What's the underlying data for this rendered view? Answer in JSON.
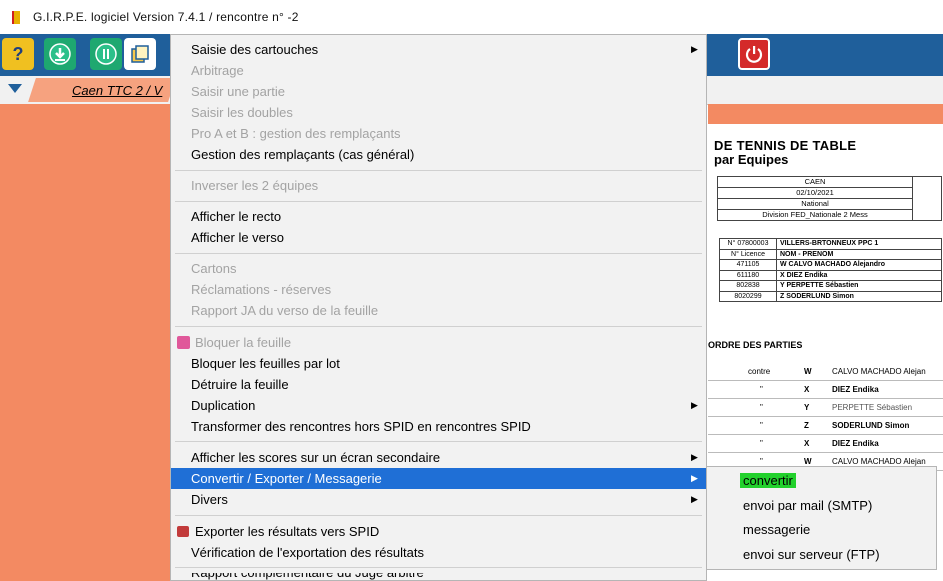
{
  "window": {
    "title": "G.I.R.P.E.  logiciel Version 7.4.1  /  rencontre n° -2"
  },
  "toolbar": {
    "icons": [
      "help-icon",
      "download-icon",
      "info-icon",
      "copy-icon",
      "power-icon"
    ],
    "help_glyph": "?"
  },
  "tab": {
    "label": "Caen TTC 2 / V"
  },
  "sheet": {
    "title": "DE TENNIS DE TABLE",
    "subtitle": "par Equipes",
    "header_box": [
      "CAEN",
      "02/10/2021",
      "National",
      "Division  FED_Nationale 2 Mess"
    ],
    "team_box": [
      [
        "N° 07800003",
        "VILLERS-BRTONNEUX PPC  1"
      ],
      [
        "N° Licence",
        "NOM - PRENOM"
      ],
      [
        "471105",
        "W  CALVO MACHADO Alejandro"
      ],
      [
        "611180",
        "X  DIEZ Endika"
      ],
      [
        "802838",
        "Y  PERPETTE  Sébastien"
      ],
      [
        "8020299",
        "Z  SODERLUND  Simon"
      ]
    ],
    "ordre_title": "ORDRE DES PARTIES",
    "ordre_rows": [
      [
        "contre",
        "W",
        "CALVO MACHADO Alejan"
      ],
      [
        "\"",
        "X",
        "DIEZ Endika"
      ],
      [
        "\"",
        "Y",
        "PERPETTE Sébastien"
      ],
      [
        "\"",
        "Z",
        "SODERLUND Simon"
      ],
      [
        "\"",
        "X",
        "DIEZ Endika"
      ],
      [
        "\"",
        "W",
        "CALVO MACHADO Alejan"
      ]
    ]
  },
  "menu": {
    "items": [
      {
        "label": "Saisie des cartouches",
        "disabled": false,
        "submenu": true
      },
      {
        "label": "Arbitrage",
        "disabled": true
      },
      {
        "label": "Saisir une partie",
        "disabled": true
      },
      {
        "label": "Saisir les doubles",
        "disabled": true
      },
      {
        "label": "Pro A et B : gestion des remplaçants",
        "disabled": true
      },
      {
        "label": "Gestion des remplaçants (cas général)",
        "disabled": false
      },
      {
        "label": "Inverser les 2 équipes",
        "disabled": true
      },
      {
        "label": "Afficher le recto",
        "disabled": false
      },
      {
        "label": "Afficher le verso",
        "disabled": false
      },
      {
        "label": "Cartons",
        "disabled": true
      },
      {
        "label": "Réclamations - réserves",
        "disabled": true
      },
      {
        "label": "Rapport JA du verso de la feuille",
        "disabled": true
      },
      {
        "label": "Bloquer la feuille",
        "disabled": true
      },
      {
        "label": "Bloquer les feuilles par lot",
        "disabled": false
      },
      {
        "label": "Détruire la feuille",
        "disabled": false
      },
      {
        "label": "Duplication",
        "disabled": false,
        "submenu": true
      },
      {
        "label": "Transformer des rencontres hors SPID en rencontres SPID",
        "disabled": false
      },
      {
        "label": "Afficher les scores sur un écran secondaire",
        "disabled": false,
        "submenu": true
      },
      {
        "label": "Convertir / Exporter / Messagerie",
        "disabled": false,
        "submenu": true,
        "highlighted": true
      },
      {
        "label": "Divers",
        "disabled": false,
        "submenu": true
      },
      {
        "label": "Exporter les résultats vers SPID",
        "disabled": false
      },
      {
        "label": "Vérification de l'exportation des résultats",
        "disabled": false
      },
      {
        "label": "Rapport complémentaire du Juge arbitre",
        "disabled": false
      }
    ],
    "submenu_arrow": "▶"
  },
  "submenu": {
    "items": [
      {
        "label": "convertir",
        "highlighted": true
      },
      {
        "label": "envoi par mail (SMTP)"
      },
      {
        "label": "messagerie"
      },
      {
        "label": "envoi sur serveur (FTP)"
      }
    ]
  },
  "colors": {
    "toolbar": "#1f5f9b",
    "panel": "#f38a62",
    "highlight": "#1f6fd6",
    "sub_highlight": "#22d12c"
  }
}
